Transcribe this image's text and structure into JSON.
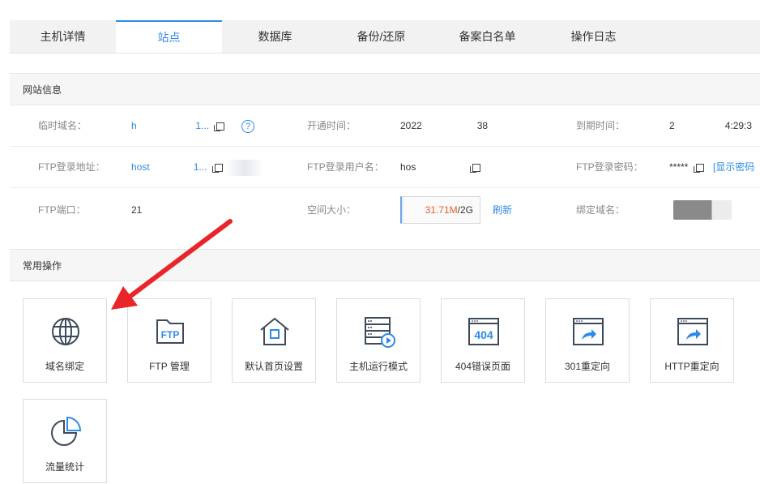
{
  "tabs": [
    "主机详情",
    "站点",
    "数据库",
    "备份/还原",
    "备案白名单",
    "操作日志"
  ],
  "active_tab": "站点",
  "site_info": {
    "title": "网站信息",
    "temp_domain_label": "临时域名：",
    "temp_domain_value": "h",
    "temp_domain_suffix": "1...",
    "open_time_label": "开通时间：",
    "open_time_prefix": "2022",
    "open_time_suffix": "38",
    "expire_time_label": "到期时间：",
    "expire_time_prefix": "2",
    "expire_time_suffix": "4:29:3",
    "ftp_addr_label": "FTP登录地址：",
    "ftp_addr_value": "host",
    "ftp_addr_suffix": "1...",
    "ftp_user_label": "FTP登录用户名：",
    "ftp_user_value": "hos",
    "ftp_pwd_label": "FTP登录密码：",
    "ftp_pwd_value": "*****",
    "show_pwd_link": "[显示密码",
    "ftp_port_label": "FTP端口：",
    "ftp_port_value": "21",
    "space_label": "空间大小：",
    "space_used": "31.71M",
    "space_total": "/2G",
    "refresh_link": "刷新",
    "bind_domain_label": "绑定域名："
  },
  "ops": {
    "title": "常用操作",
    "tiles": [
      {
        "label": "域名绑定",
        "icon": "globe-icon"
      },
      {
        "label": "FTP 管理",
        "icon": "ftp-folder-icon"
      },
      {
        "label": "默认首页设置",
        "icon": "home-icon"
      },
      {
        "label": "主机运行模式",
        "icon": "server-play-icon"
      },
      {
        "label": "404错误页面",
        "icon": "404-page-icon"
      },
      {
        "label": "301重定向",
        "icon": "redirect-icon"
      },
      {
        "label": "HTTP重定向",
        "icon": "redirect-icon"
      },
      {
        "label": "流量统计",
        "icon": "pie-chart-icon"
      }
    ]
  },
  "colors": {
    "accent": "#2e8ae6",
    "warning": "#f05a28",
    "annotation_arrow": "#e8262a"
  }
}
